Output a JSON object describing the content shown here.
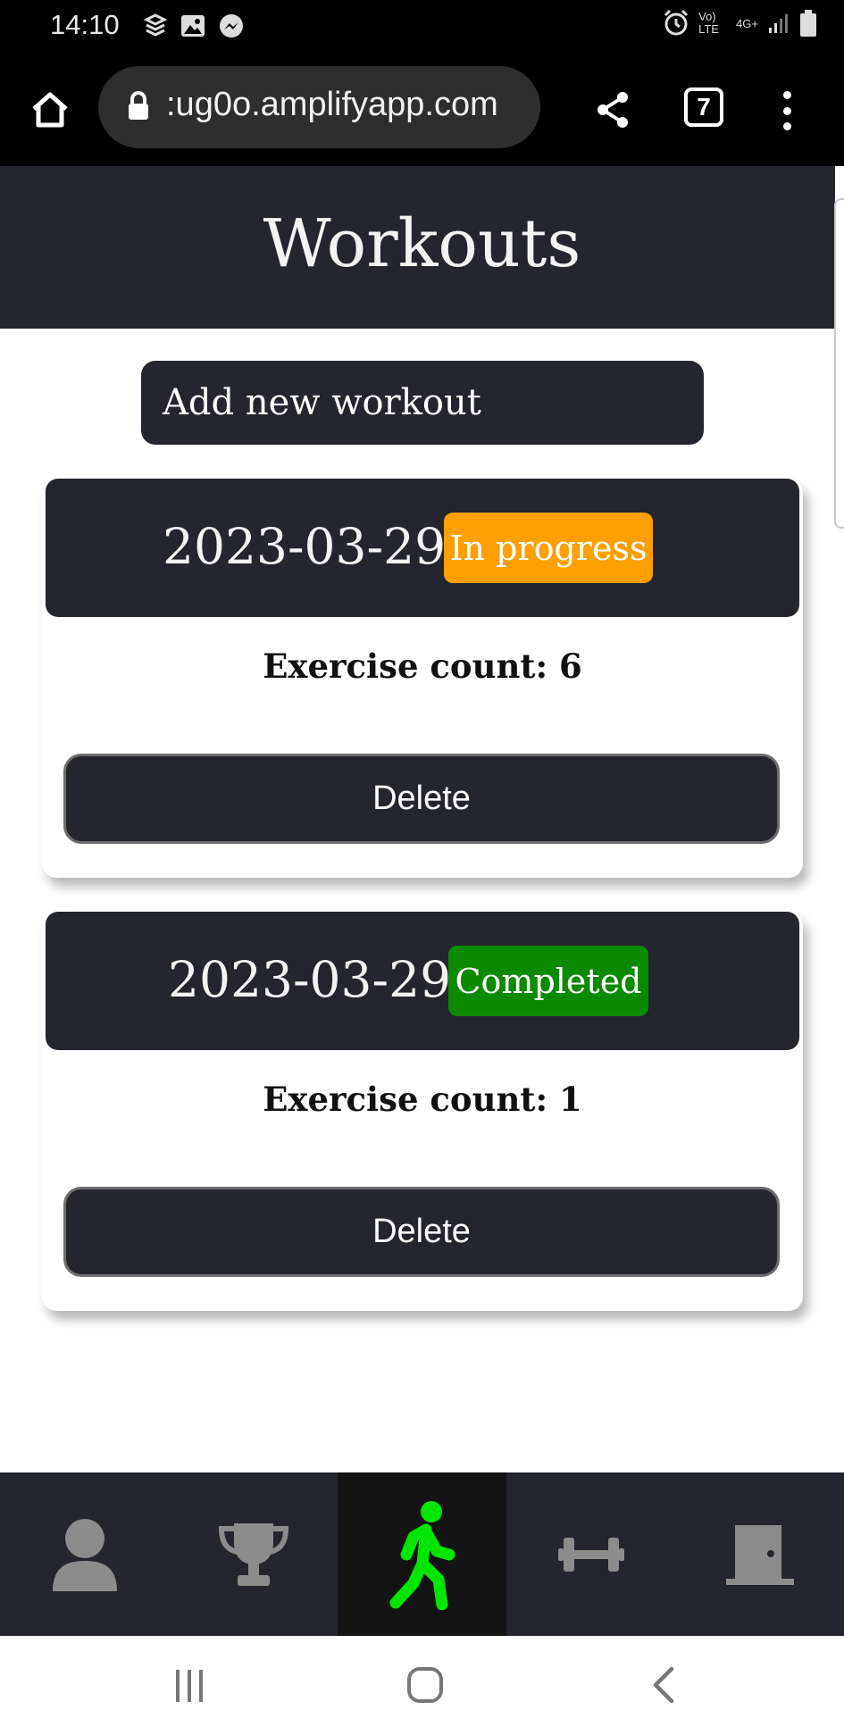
{
  "status_bar": {
    "time": "14:10",
    "network_label": "Vo) LTE",
    "signal_label": "4G+"
  },
  "browser": {
    "url": ":ug0o.amplifyapp.com",
    "tab_count": "7"
  },
  "header": {
    "title": "Workouts"
  },
  "actions": {
    "add_workout_label": "Add new workout"
  },
  "workouts": [
    {
      "date": "2023-03-29",
      "status": "In progress",
      "status_color": "#ff9f00",
      "exercise_count": "Exercise count: 6",
      "delete_label": "Delete"
    },
    {
      "date": "2023-03-29",
      "status": "Completed",
      "status_color": "#0b8a00",
      "exercise_count": "Exercise count: 1",
      "delete_label": "Delete"
    }
  ],
  "bottom_nav": {
    "items": [
      {
        "icon": "user-icon"
      },
      {
        "icon": "trophy-icon"
      },
      {
        "icon": "walking-person-icon",
        "active": true
      },
      {
        "icon": "dumbbell-icon"
      },
      {
        "icon": "door-icon"
      }
    ],
    "active_color": "#00e600",
    "inactive_color": "#8c8c8c"
  },
  "colors": {
    "dark_surface": "#24252f",
    "accent_green": "#00e600"
  }
}
